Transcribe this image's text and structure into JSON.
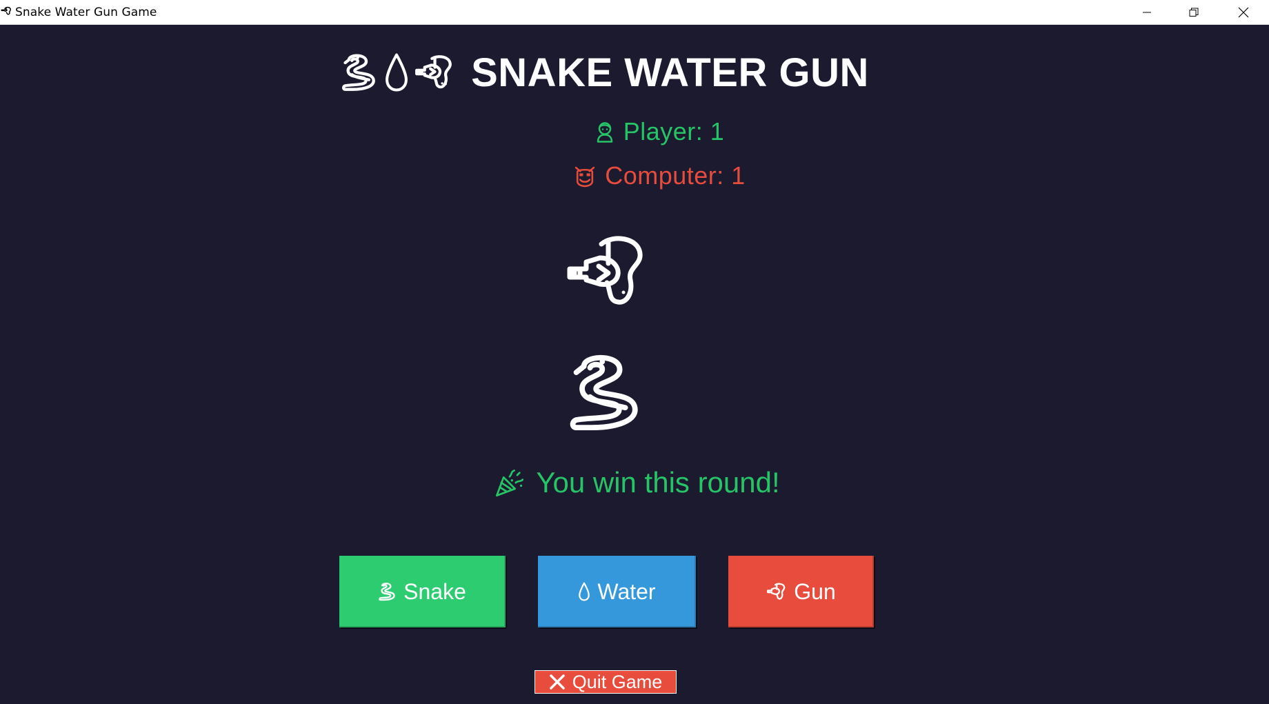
{
  "window": {
    "title": "Snake Water Gun Game",
    "icon": "water-gun-icon"
  },
  "game": {
    "heading": "SNAKE WATER GUN",
    "heading_icons": [
      "snake-icon",
      "water-drop-icon",
      "water-gun-icon"
    ],
    "score": {
      "player_label": "Player: 1",
      "player_icon": "person-icon",
      "computer_label": "Computer: 1",
      "computer_icon": "robot-icon"
    },
    "computer_choice_icon": "water-gun-icon",
    "player_choice_icon": "snake-icon",
    "result": {
      "text": "You win this round!",
      "icon": "party-popper-icon"
    },
    "buttons": {
      "snake": "Snake",
      "water": "Water",
      "gun": "Gun",
      "quit": "Quit Game"
    }
  },
  "colors": {
    "background": "#1b1a2f",
    "player": "#27c467",
    "computer": "#e74c3c",
    "snake_button": "#2ecc71",
    "water_button": "#3498db",
    "gun_button": "#e74c3c"
  }
}
